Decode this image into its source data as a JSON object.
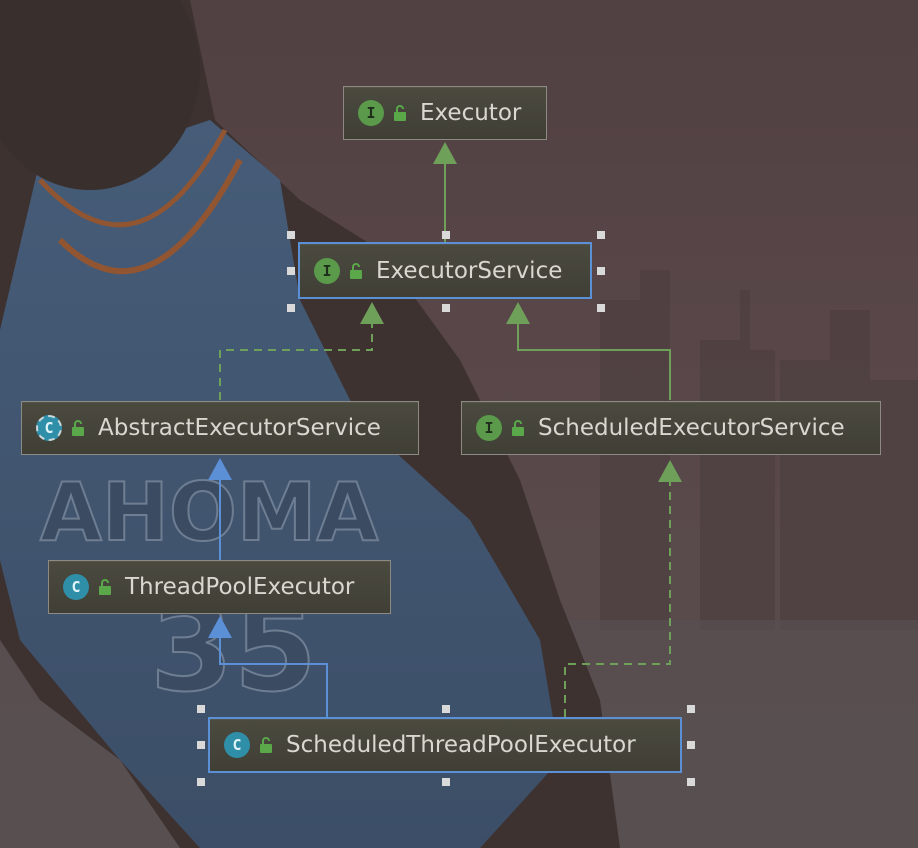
{
  "diagram": {
    "nodes": [
      {
        "id": "executor",
        "label": "Executor",
        "kind": "I"
      },
      {
        "id": "executor-service",
        "label": "ExecutorService",
        "kind": "I"
      },
      {
        "id": "abstract-executor-service",
        "label": "AbstractExecutorService",
        "kind": "C"
      },
      {
        "id": "scheduled-executor-service",
        "label": "ScheduledExecutorService",
        "kind": "I"
      },
      {
        "id": "thread-pool-executor",
        "label": "ThreadPoolExecutor",
        "kind": "C"
      },
      {
        "id": "scheduled-thread-pool-executor",
        "label": "ScheduledThreadPoolExecutor",
        "kind": "C"
      }
    ],
    "edges": [
      {
        "from": "executor-service",
        "to": "executor",
        "type": "extends-interface"
      },
      {
        "from": "abstract-executor-service",
        "to": "executor-service",
        "type": "implements"
      },
      {
        "from": "scheduled-executor-service",
        "to": "executor-service",
        "type": "extends-interface"
      },
      {
        "from": "thread-pool-executor",
        "to": "abstract-executor-service",
        "type": "extends"
      },
      {
        "from": "scheduled-thread-pool-executor",
        "to": "thread-pool-executor",
        "type": "extends"
      },
      {
        "from": "scheduled-thread-pool-executor",
        "to": "scheduled-executor-service",
        "type": "implements"
      }
    ]
  },
  "colors": {
    "interface_badge": "#5a9a4a",
    "class_badge": "#2f8fa8",
    "interface_arrow": "#6fa05a",
    "class_arrow": "#5b8fd6",
    "selection": "#5b8fd6"
  },
  "icons": {
    "interface": "interface-icon",
    "class": "class-icon",
    "abstract_class": "abstract-class-icon",
    "access": "unlocked-public-icon"
  }
}
